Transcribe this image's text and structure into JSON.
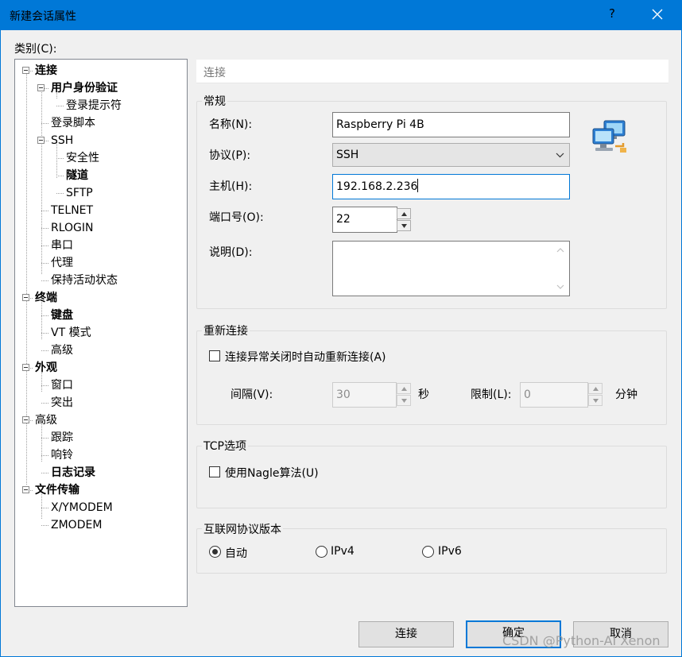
{
  "window": {
    "title": "新建会话属性",
    "help": "?"
  },
  "category_label": "类别(C):",
  "tree": [
    "连接",
    "用户身份验证",
    "登录提示符",
    "登录脚本",
    "SSH",
    "安全性",
    "隧道",
    "SFTP",
    "TELNET",
    "RLOGIN",
    "串口",
    "代理",
    "保持活动状态",
    "终端",
    "键盘",
    "VT 模式",
    "高级",
    "外观",
    "窗口",
    "突出",
    "高级",
    "跟踪",
    "响铃",
    "日志记录",
    "文件传输",
    "X/YMODEM",
    "ZMODEM"
  ],
  "panel_header": "连接",
  "general": {
    "title": "常规",
    "name_label": "名称(N):",
    "name_value": "Raspberry Pi 4B",
    "protocol_label": "协议(P):",
    "protocol_value": "SSH",
    "host_label": "主机(H):",
    "host_value": "192.168.2.236",
    "port_label": "端口号(O):",
    "port_value": "22",
    "desc_label": "说明(D):",
    "desc_value": ""
  },
  "reconnect": {
    "title": "重新连接",
    "checkbox_label": "连接异常关闭时自动重新连接(A)",
    "checked": false,
    "interval_label": "间隔(V):",
    "interval_value": "30",
    "interval_unit": "秒",
    "limit_label": "限制(L):",
    "limit_value": "0",
    "limit_unit": "分钟"
  },
  "tcp": {
    "title": "TCP选项",
    "nagle_label": "使用Nagle算法(U)",
    "checked": false
  },
  "ip_version": {
    "title": "互联网协议版本",
    "options": [
      "自动",
      "IPv4",
      "IPv6"
    ],
    "selected": "自动"
  },
  "buttons": {
    "connect": "连接",
    "ok": "确定",
    "cancel": "取消"
  },
  "watermark": "CSDN @Python-AI Xenon"
}
